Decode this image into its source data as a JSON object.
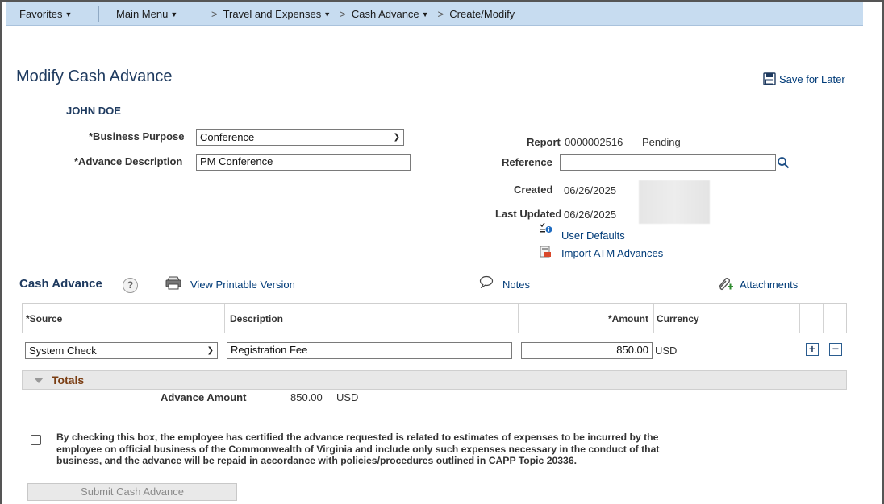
{
  "nav": {
    "favorites": "Favorites",
    "main_menu": "Main Menu",
    "crumb_travel": "Travel and Expenses",
    "crumb_cash": "Cash Advance",
    "crumb_create": "Create/Modify"
  },
  "page": {
    "title": "Modify Cash Advance",
    "save_for_later": "Save for Later"
  },
  "employee": {
    "name": "JOHN DOE"
  },
  "form": {
    "business_purpose_label": "*Business Purpose",
    "business_purpose_value": "Conference",
    "advance_description_label": "*Advance Description",
    "advance_description_value": "PM Conference",
    "report_label": "Report",
    "report_number": "0000002516",
    "report_status": "Pending",
    "reference_label": "Reference",
    "reference_value": "",
    "created_label": "Created",
    "created_date": "06/26/2025",
    "last_updated_label": "Last Updated",
    "last_updated_date": "06/26/2025",
    "user_defaults_link": "User Defaults",
    "import_atm_link": "Import ATM Advances"
  },
  "cash_advance": {
    "title": "Cash Advance",
    "help": "?",
    "view_printable": "View Printable Version",
    "notes": "Notes",
    "attachments": "Attachments",
    "columns": {
      "source": "*Source",
      "description": "Description",
      "amount": "*Amount",
      "currency": "Currency"
    },
    "rows": [
      {
        "source": "System Check",
        "description": "Registration Fee",
        "amount": "850.00",
        "currency": "USD"
      }
    ],
    "add_row": "+",
    "delete_row": "−"
  },
  "totals": {
    "title": "Totals",
    "advance_amount_label": "Advance Amount",
    "advance_amount_value": "850.00",
    "advance_amount_currency": "USD"
  },
  "certification": {
    "text": "By checking this box, the employee has certified the advance requested is related to estimates of expenses to be incurred by the employee on official business of the Commonwealth of Virginia and include only such expenses necessary in the conduct of that business, and the advance will be repaid in accordance with policies/procedures outlined in CAPP Topic 20336.",
    "checked": false
  },
  "submit": {
    "label": "Submit Cash Advance"
  },
  "icons": {
    "save": "floppy-disk-icon",
    "search": "magnifier-icon",
    "user_defaults": "user-settings-icon",
    "import": "import-icon",
    "print": "printer-icon",
    "notes": "speech-bubble-icon",
    "attachments": "paperclip-plus-icon"
  },
  "colors": {
    "topbar": "#c7dcf0",
    "title": "#1e3a5f",
    "link": "#003b78",
    "totals_text": "#7a3d12"
  }
}
